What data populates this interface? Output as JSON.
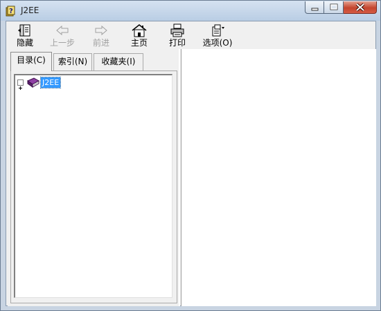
{
  "window": {
    "title": "J2EE"
  },
  "toolbar": {
    "buttons": [
      {
        "label": "隐藏",
        "icon": "hide-icon",
        "enabled": true
      },
      {
        "label": "上一步",
        "icon": "back-arrow-icon",
        "enabled": false
      },
      {
        "label": "前进",
        "icon": "forward-arrow-icon",
        "enabled": false
      },
      {
        "label": "主页",
        "icon": "home-icon",
        "enabled": true
      },
      {
        "label": "打印",
        "icon": "printer-icon",
        "enabled": true
      },
      {
        "label": "选项(O)",
        "icon": "options-icon",
        "enabled": true
      }
    ]
  },
  "tabs": [
    {
      "label": "目录(C)",
      "active": true
    },
    {
      "label": "索引(N)",
      "active": false
    },
    {
      "label": "收藏夹(I)",
      "active": false
    }
  ],
  "tree": {
    "nodes": [
      {
        "label": "J2EE",
        "icon": "book-icon",
        "expander": "+",
        "selected": true
      }
    ]
  },
  "colors": {
    "selection": "#3399ff",
    "titlebar": "#c8d4e2",
    "close_button": "#c4452e"
  }
}
